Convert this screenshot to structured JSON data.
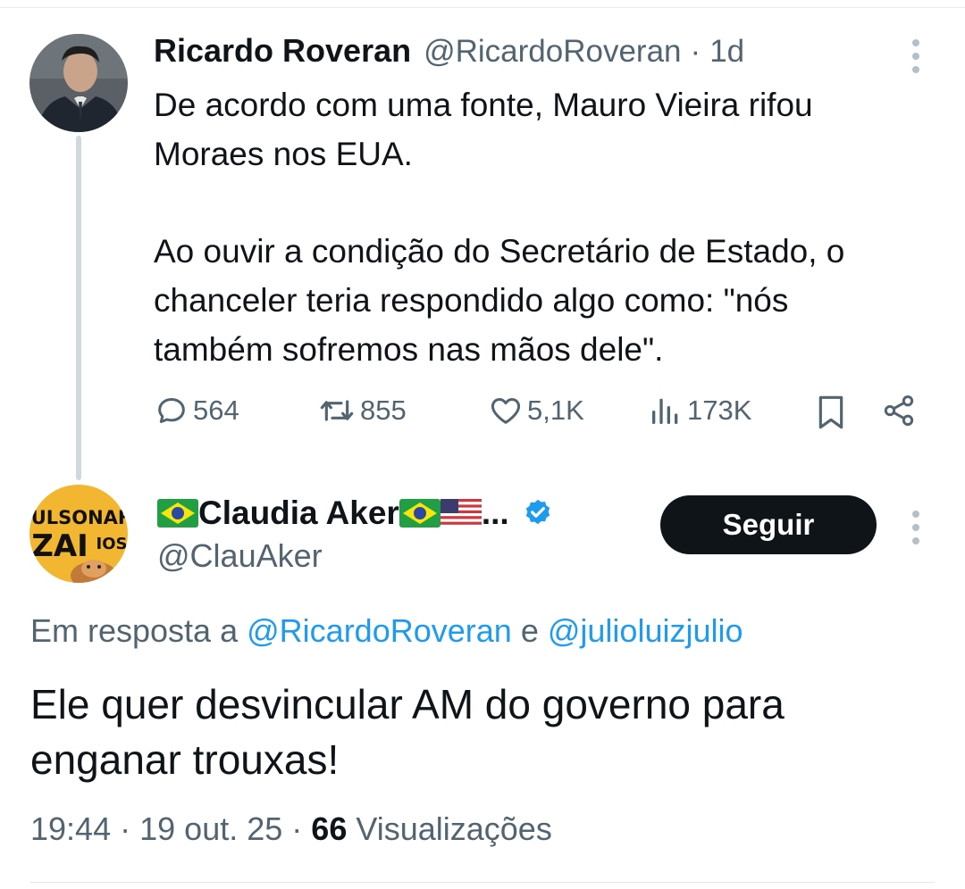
{
  "parent_tweet": {
    "author_name": "Ricardo Roveran",
    "handle": "@RicardoRoveran",
    "separator": "·",
    "time": "1d",
    "text_lines": [
      "De acordo com uma fonte, Mauro Vieira rifou",
      "Moraes nos EUA.",
      "Ao ouvir a condição do Secretário de Estado, o",
      "chanceler teria respondido algo como: \"nós",
      "também sofremos nas mãos dele\"."
    ],
    "stats": {
      "replies": "564",
      "retweets": "855",
      "likes": "5,1K",
      "views": "173K"
    },
    "icons": [
      "reply-icon",
      "retweet-icon",
      "like-icon",
      "views-icon",
      "bookmark-icon",
      "share-icon",
      "more-icon"
    ]
  },
  "reply_tweet": {
    "author_name_prefix_icon": "brazil-flag-icon",
    "author_name": "Claudia Aker",
    "author_name_suffix_icons": [
      "brazil-flag-icon",
      "usa-flag-icon"
    ],
    "author_name_ellipsis": "...",
    "verified_icon": "verified-badge-icon",
    "handle": "@ClauAker",
    "follow_label": "Seguir",
    "reply_prefix": "Em resposta a",
    "reply_user1": "@RicardoRoveran",
    "reply_connector": "e",
    "reply_user2": "@julioluizjulio",
    "text": "Ele quer desvincular AM do governo para enganar trouxas!",
    "time": "19:44",
    "date": "19 out. 25",
    "separator": "·",
    "views_count": "66",
    "views_label": "Visualizações",
    "avatar_text_line1": "BULSONAHI",
    "avatar_text_line2": "ZAI",
    "avatar_text_line3": "IOS"
  },
  "colors": {
    "text_primary": "#0f1419",
    "text_secondary": "#536471",
    "link": "#1d9bf0",
    "verified": "#1d9bf0",
    "thread_line": "#cfd9de",
    "follow_button_bg": "#0f1419"
  }
}
